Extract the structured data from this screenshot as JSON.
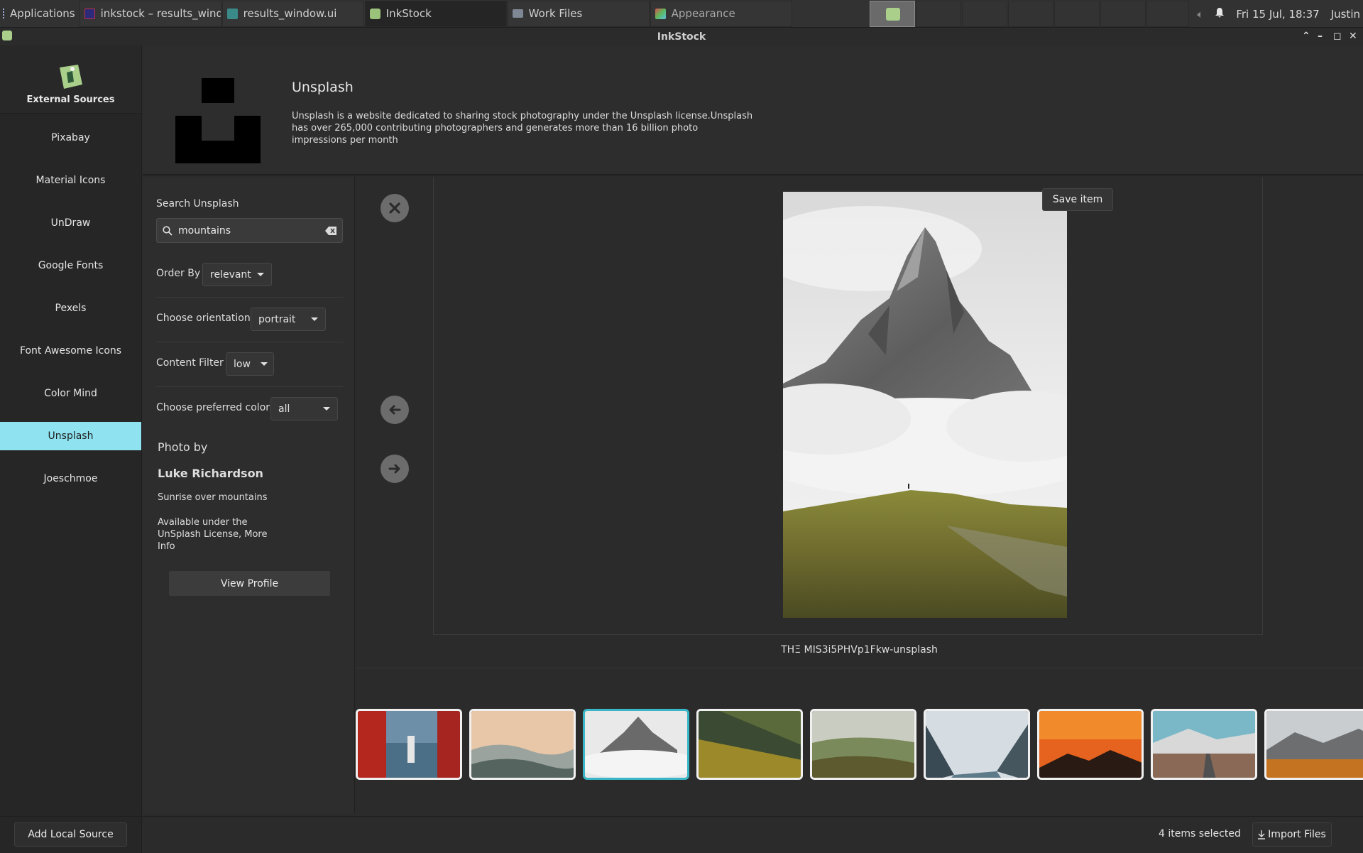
{
  "taskbar": {
    "applications_label": "Applications",
    "tasks": [
      {
        "label": "inkstock – results_wind..."
      },
      {
        "label": "results_window.ui"
      },
      {
        "label": "InkStock"
      },
      {
        "label": "Work Files"
      },
      {
        "label": "Appearance"
      }
    ],
    "clock": "Fri 15 Jul, 18:37",
    "user": "Justin"
  },
  "window": {
    "title": "InkStock",
    "controls": {
      "up": "^",
      "minimize": "–",
      "maximize": "□",
      "close": "✕"
    }
  },
  "sidebar": {
    "heading": "External Sources",
    "items": [
      {
        "label": "Pixabay"
      },
      {
        "label": "Material Icons"
      },
      {
        "label": "UnDraw"
      },
      {
        "label": "Google Fonts"
      },
      {
        "label": "Pexels"
      },
      {
        "label": "Font Awesome Icons"
      },
      {
        "label": "Color Mind"
      },
      {
        "label": "Unsplash"
      },
      {
        "label": "Joeschmoe"
      }
    ],
    "active_item": "Unsplash",
    "add_local_source": "Add Local Source"
  },
  "source": {
    "title": "Unsplash",
    "description": "Unsplash is a website dedicated to sharing stock photography under the Unsplash license.Unsplash has over 265,000 contributing photographers and generates more than 16 billion photo impressions per month"
  },
  "search": {
    "label": "Search Unsplash",
    "value": "mountains"
  },
  "filters": {
    "order_by_label": "Order By",
    "order_by_value": "relevant",
    "orientation_label": "Choose orientation",
    "orientation_value": "portrait",
    "content_filter_label": "Content Filter",
    "content_filter_value": "low",
    "color_label": "Choose preferred color",
    "color_value": "all"
  },
  "photo": {
    "photo_by_label": "Photo by",
    "author": "Luke Richardson",
    "title": "Sunrise over mountains",
    "license_text": "Available under the UnSplash License, More Info",
    "view_profile_label": "View Profile",
    "filename": "THΞ MIS3i5PHVp1Fkw-unsplash"
  },
  "viewer": {
    "save_item_label": "Save item"
  },
  "thumbnails": {
    "count": 9,
    "selected_index": 2
  },
  "status": {
    "selection_text": "4 items selected",
    "import_label": "Import Files"
  },
  "colors": {
    "accent": "#8fe3f0",
    "selection_border": "#3ab6c9"
  }
}
